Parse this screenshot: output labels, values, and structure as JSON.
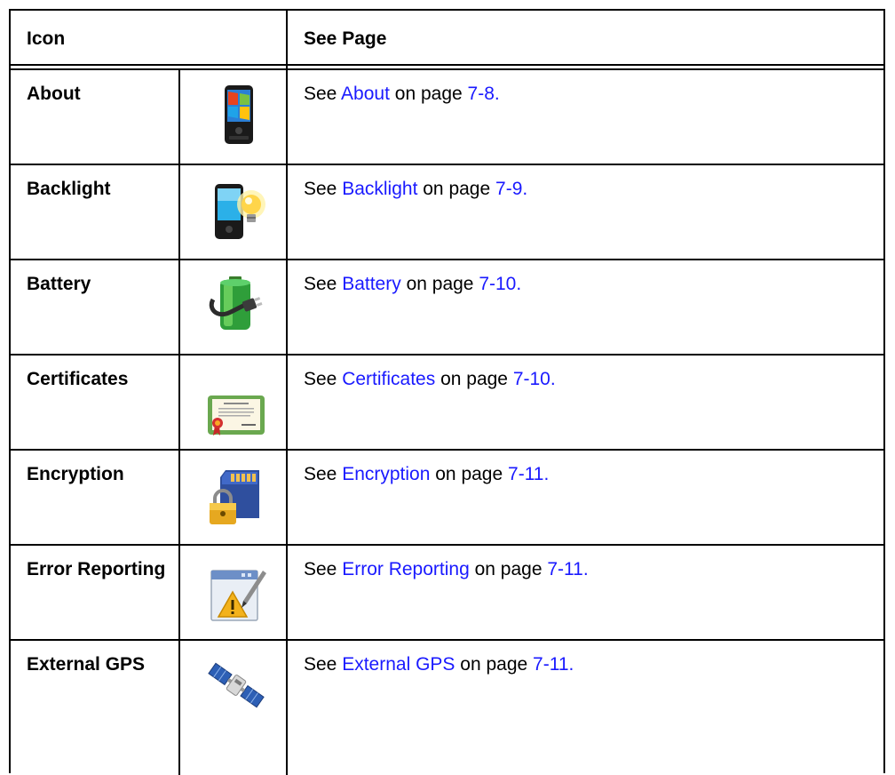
{
  "table": {
    "header": {
      "icon": "Icon",
      "see_page": "See Page"
    },
    "rows": [
      {
        "name": "About",
        "see": "See ",
        "link": "About",
        "mid": " on page ",
        "page": "7-8.",
        "icon": "pda-phone-icon"
      },
      {
        "name": "Backlight",
        "see": "See ",
        "link": "Backlight",
        "mid": " on page ",
        "page": "7-9.",
        "icon": "backlight-bulb-icon"
      },
      {
        "name": "Battery",
        "see": "See ",
        "link": "Battery",
        "mid": " on page ",
        "page": "7-10.",
        "icon": "battery-plug-icon"
      },
      {
        "name": "Certificates",
        "see": "See ",
        "link": "Certificates",
        "mid": " on page ",
        "page": "7-10.",
        "icon": "certificate-icon"
      },
      {
        "name": "Encryption",
        "see": "See ",
        "link": "Encryption",
        "mid": " on page ",
        "page": "7-11.",
        "icon": "sd-card-lock-icon"
      },
      {
        "name": "Error Reporting",
        "see": "See ",
        "link": "Error Reporting",
        "mid": " on page ",
        "page": "7-11.",
        "icon": "error-report-icon"
      },
      {
        "name": "External GPS",
        "see": "See ",
        "link": "External GPS",
        "mid": " on page ",
        "page": "7-11.",
        "icon": "satellite-icon"
      }
    ]
  },
  "colors": {
    "link": "#1a1aff",
    "border": "#000000"
  }
}
